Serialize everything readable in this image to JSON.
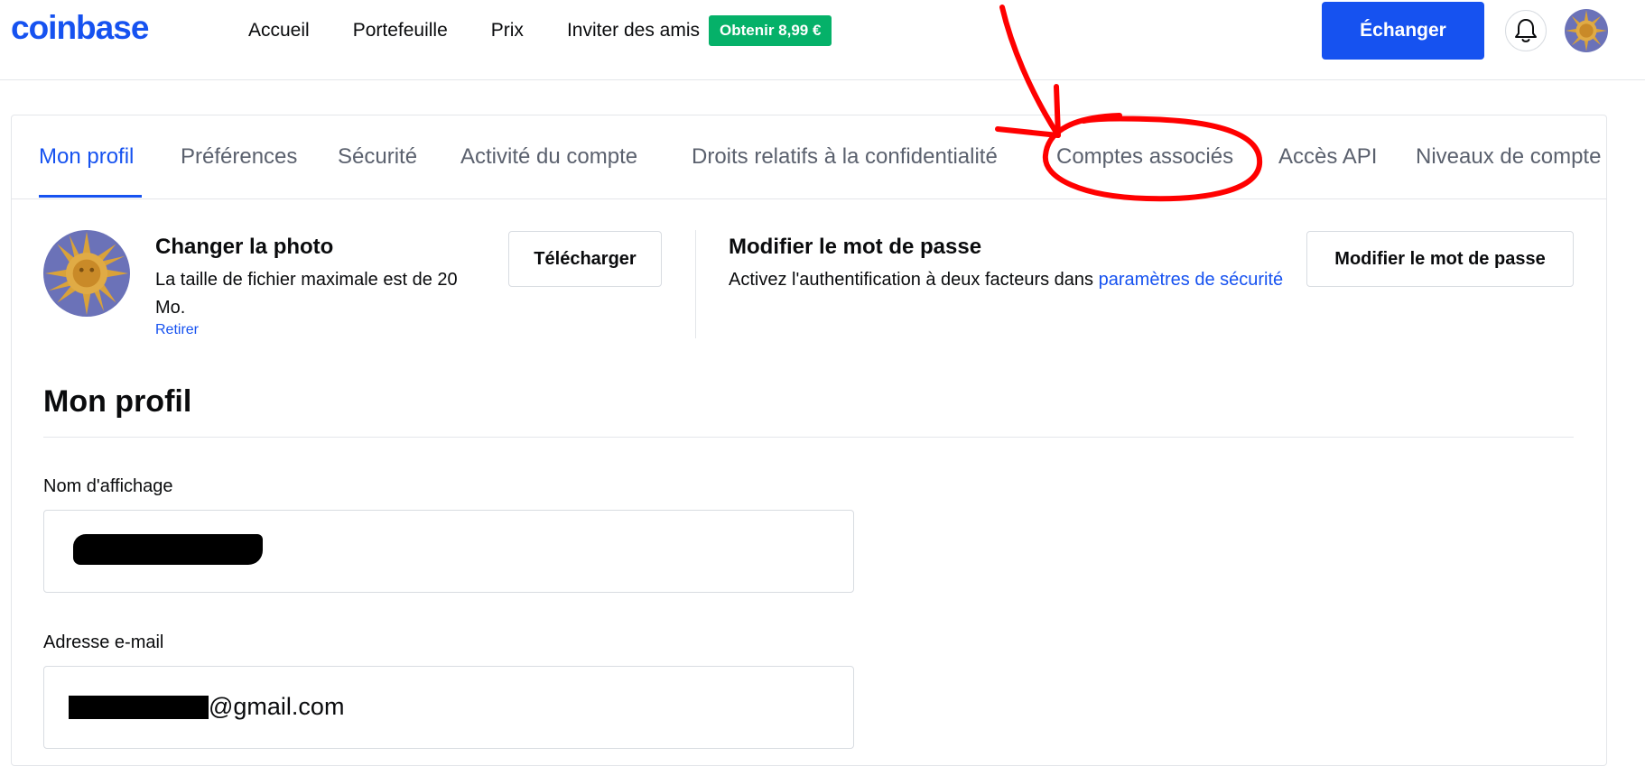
{
  "header": {
    "logo": "coinbase",
    "nav": [
      "Accueil",
      "Portefeuille",
      "Prix",
      "Inviter des amis"
    ],
    "promo_badge": "Obtenir 8,99 €",
    "trade_button": "Échanger",
    "icons": [
      "bell-icon",
      "avatar"
    ]
  },
  "tabs": [
    {
      "label": "Mon profil",
      "active": true
    },
    {
      "label": "Préférences",
      "active": false
    },
    {
      "label": "Sécurité",
      "active": false
    },
    {
      "label": "Activité du compte",
      "active": false
    },
    {
      "label": "Droits relatifs à la confidentialité",
      "active": false
    },
    {
      "label": "Comptes associés",
      "active": false
    },
    {
      "label": "Accès API",
      "active": false
    },
    {
      "label": "Niveaux de compte",
      "active": false
    }
  ],
  "photo": {
    "title": "Changer la photo",
    "description": "La taille de fichier maximale est de 20 Mo.",
    "remove_link": "Retirer",
    "upload_button": "Télécharger"
  },
  "password": {
    "title": "Modifier le mot de passe",
    "description": "Activez l'authentification à deux facteurs dans",
    "link": "paramètres de sécurité",
    "button": "Modifier le mot de passe"
  },
  "profile": {
    "heading": "Mon profil",
    "display_name_label": "Nom d'affichage",
    "display_name_value": "",
    "email_label": "Adresse e-mail",
    "email_visible_suffix": "@gmail.com"
  },
  "colors": {
    "brand_blue": "#1652f0",
    "promo_green": "#05b169",
    "annotation_red": "#ff0000"
  }
}
